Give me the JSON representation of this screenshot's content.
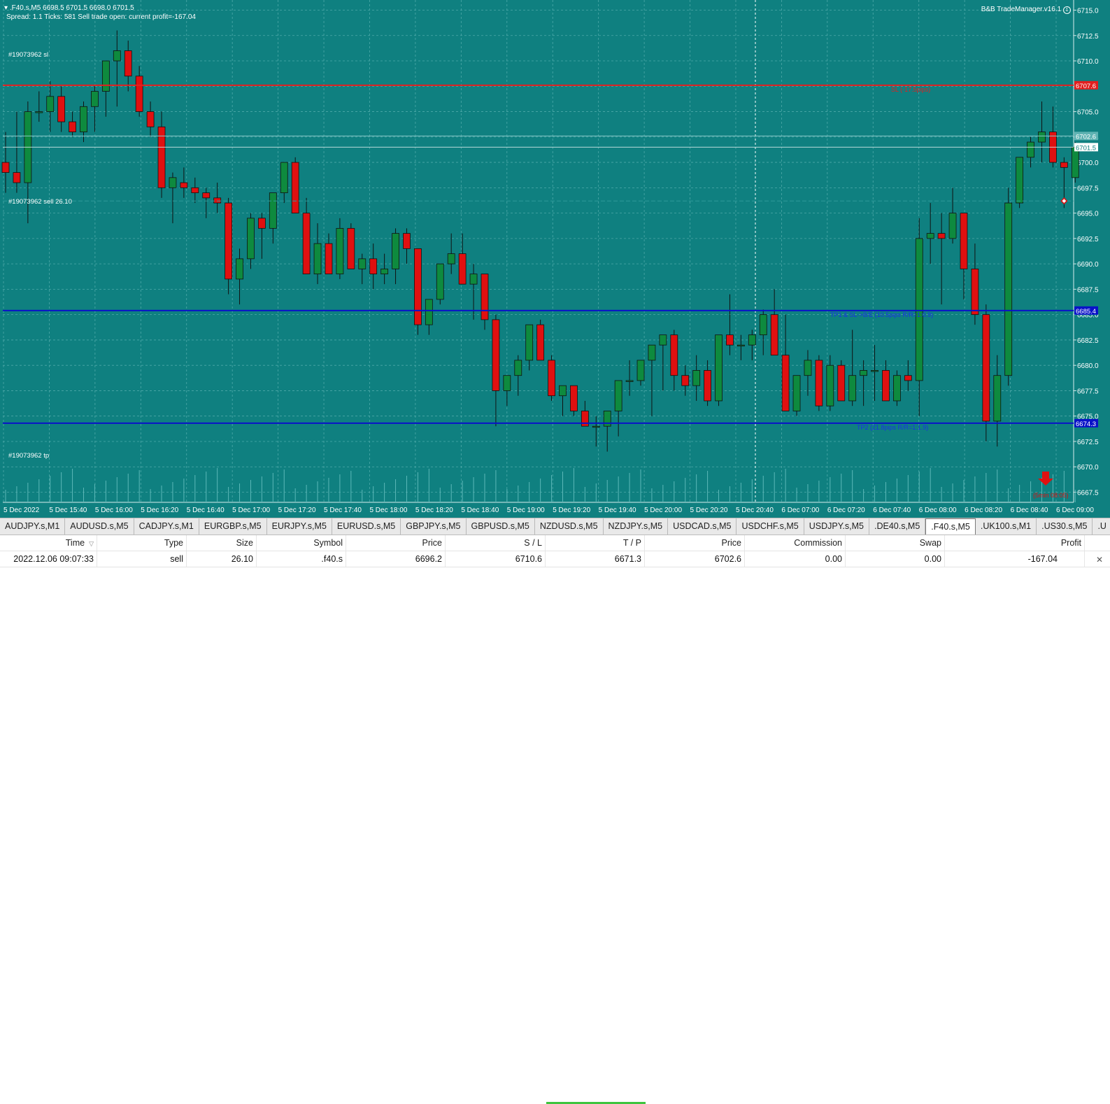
{
  "chart_header": {
    "symbol_line": ".F40.s,M5  6698.5 6701.5 6698.0 6701.5",
    "info_line": "Spread: 1.1  Ticks: 581  Sell trade open: current profit=-167.04",
    "brand": "B&B TradeManager.v16.1"
  },
  "chart_labels": {
    "order_sl": "#19073962 sl",
    "order_sell": "#19073962 sell 26.10",
    "order_tp": "#19073962 tp",
    "sl_text": "SL (-17.5pips)",
    "tp1_text": "TP1 & SL->B/E (10.5pips R/R=1:0.9)",
    "tp2_text": "TP2 (21.8pips R/R=1:1.9)",
    "timer": "(5min 08:05)"
  },
  "colors": {
    "background": "#0f8080",
    "bull": "#0e8a3e",
    "bear": "#e01010",
    "sl_line": "#e21f1f",
    "tp_line": "#0a12c8",
    "grid": "#4fa9a9"
  },
  "chart_data": {
    "type": "candlestick",
    "symbol": ".F40.s",
    "timeframe": "M5",
    "ylim": [
      6666.5,
      6716
    ],
    "yticks": [
      6715.0,
      6712.5,
      6710.0,
      6707.5,
      6705.0,
      6702.5,
      6700.0,
      6697.5,
      6695.0,
      6692.5,
      6690.0,
      6687.5,
      6685.0,
      6682.5,
      6680.0,
      6677.5,
      6675.0,
      6672.5,
      6670.0,
      6667.5
    ],
    "price_tags": {
      "sl": "6707.6",
      "ask": "6702.6",
      "bid": "6701.5",
      "tp1": "6685.4",
      "tp2": "6674.3"
    },
    "levels": {
      "sl": 6707.6,
      "ask": 6702.6,
      "bid": 6701.5,
      "tp1": 6685.4,
      "tp2": 6674.3,
      "entry": 6696.2
    },
    "xticks": [
      "5 Dec 2022",
      "5 Dec 15:40",
      "5 Dec 16:00",
      "5 Dec 16:20",
      "5 Dec 16:40",
      "5 Dec 17:00",
      "5 Dec 17:20",
      "5 Dec 17:40",
      "5 Dec 18:00",
      "5 Dec 18:20",
      "5 Dec 18:40",
      "5 Dec 19:00",
      "5 Dec 19:20",
      "5 Dec 19:40",
      "5 Dec 20:00",
      "5 Dec 20:20",
      "5 Dec 20:40",
      "6 Dec 07:00",
      "6 Dec 07:20",
      "6 Dec 07:40",
      "6 Dec 08:00",
      "6 Dec 08:20",
      "6 Dec 08:40",
      "6 Dec 09:00"
    ],
    "candles": [
      [
        6700,
        6703,
        6697,
        6699
      ],
      [
        6699,
        6705,
        6697,
        6698
      ],
      [
        6698,
        6706,
        6694,
        6705
      ],
      [
        6705,
        6707,
        6704,
        6705
      ],
      [
        6705,
        6708,
        6703,
        6706.5
      ],
      [
        6706.5,
        6707.5,
        6703,
        6704
      ],
      [
        6704,
        6705,
        6702.5,
        6703
      ],
      [
        6703,
        6706,
        6702,
        6705.5
      ],
      [
        6705.5,
        6707.5,
        6703,
        6707
      ],
      [
        6707,
        6709.5,
        6704.5,
        6710
      ],
      [
        6710,
        6713,
        6705.5,
        6711
      ],
      [
        6711,
        6712,
        6707,
        6708.5
      ],
      [
        6708.5,
        6709.5,
        6704.5,
        6705
      ],
      [
        6705,
        6706,
        6702.5,
        6703.5
      ],
      [
        6703.5,
        6705,
        6696.5,
        6697.5
      ],
      [
        6697.5,
        6699,
        6694,
        6698.5
      ],
      [
        6698,
        6699.5,
        6696.5,
        6697.5
      ],
      [
        6697.5,
        6698.5,
        6696,
        6697
      ],
      [
        6697,
        6697.5,
        6694.5,
        6696.5
      ],
      [
        6696.5,
        6698,
        6695,
        6696
      ],
      [
        6696,
        6696.5,
        6687,
        6688.5
      ],
      [
        6688.5,
        6691.5,
        6686,
        6690.5
      ],
      [
        6690.5,
        6695,
        6689.5,
        6694.5
      ],
      [
        6694.5,
        6695,
        6690.5,
        6693.5
      ],
      [
        6693.5,
        6696.5,
        6692,
        6697
      ],
      [
        6697,
        6699,
        6696,
        6700
      ],
      [
        6700,
        6700.5,
        6696,
        6695
      ],
      [
        6695,
        6696.5,
        6689,
        6689
      ],
      [
        6689,
        6694,
        6688,
        6692
      ],
      [
        6692,
        6693,
        6689,
        6689
      ],
      [
        6689,
        6694.5,
        6688.5,
        6693.5
      ],
      [
        6693.5,
        6694,
        6691,
        6689.5
      ],
      [
        6689.5,
        6691,
        6688,
        6690.5
      ],
      [
        6690.5,
        6692,
        6687.5,
        6689
      ],
      [
        6689,
        6691,
        6688,
        6689.5
      ],
      [
        6689.5,
        6693.5,
        6688,
        6693
      ],
      [
        6693,
        6693.5,
        6690,
        6691.5
      ],
      [
        6691.5,
        6691.5,
        6683,
        6684
      ],
      [
        6684,
        6686.5,
        6683,
        6686.5
      ],
      [
        6686.5,
        6690,
        6686,
        6690
      ],
      [
        6690,
        6693,
        6689,
        6691
      ],
      [
        6691,
        6693,
        6689,
        6688
      ],
      [
        6688,
        6690,
        6684.5,
        6689
      ],
      [
        6689,
        6689,
        6683.5,
        6684.5
      ],
      [
        6684.5,
        6685,
        6674,
        6677.5
      ],
      [
        6677.5,
        6679,
        6676,
        6679
      ],
      [
        6679,
        6681,
        6677,
        6680.5
      ],
      [
        6680.5,
        6683.5,
        6679.5,
        6684
      ],
      [
        6684,
        6684.5,
        6681,
        6680.5
      ],
      [
        6680.5,
        6681,
        6676.5,
        6677
      ],
      [
        6677,
        6677.5,
        6675,
        6678
      ],
      [
        6678,
        6678,
        6675,
        6675.5
      ],
      [
        6675.5,
        6676.5,
        6675,
        6674
      ],
      [
        6674,
        6675,
        6672,
        6674
      ],
      [
        6674,
        6675,
        6671.5,
        6675.5
      ],
      [
        6675.5,
        6678.5,
        6673,
        6678.5
      ],
      [
        6678.5,
        6680.5,
        6677,
        6678.5
      ],
      [
        6678.5,
        6680.5,
        6678,
        6680.5
      ],
      [
        6680.5,
        6681.5,
        6675,
        6682
      ],
      [
        6682,
        6683,
        6677.5,
        6683
      ],
      [
        6683,
        6683.5,
        6677.5,
        6679
      ],
      [
        6679,
        6680,
        6677,
        6678
      ],
      [
        6678,
        6681,
        6676.5,
        6679.5
      ],
      [
        6679.5,
        6680.5,
        6676,
        6676.5
      ],
      [
        6676.5,
        6683,
        6676,
        6683
      ],
      [
        6683,
        6687,
        6681,
        6682
      ],
      [
        6682,
        6683,
        6680.5,
        6682
      ],
      [
        6682,
        6683.5,
        6680.5,
        6683
      ],
      [
        6683,
        6685.5,
        6681,
        6685
      ],
      [
        6685,
        6687.5,
        6681,
        6681
      ],
      [
        6681,
        6685,
        6675.5,
        6675.5
      ],
      [
        6675.5,
        6679,
        6675,
        6679
      ],
      [
        6679,
        6681.5,
        6677,
        6680.5
      ],
      [
        6680.5,
        6681,
        6675.5,
        6676
      ],
      [
        6676,
        6681,
        6675.5,
        6680
      ],
      [
        6680,
        6680.5,
        6676.5,
        6676.5
      ],
      [
        6676.5,
        6683.5,
        6676,
        6679
      ],
      [
        6679,
        6680.5,
        6676,
        6679.5
      ],
      [
        6679.5,
        6682,
        6676.5,
        6679.5
      ],
      [
        6679.5,
        6680.5,
        6676.5,
        6676.5
      ],
      [
        6676.5,
        6679.5,
        6676,
        6679
      ],
      [
        6679,
        6680.5,
        6677.5,
        6678.5
      ],
      [
        6678.5,
        6694.5,
        6675,
        6692.5
      ],
      [
        6692.5,
        6696,
        6690,
        6693
      ],
      [
        6693,
        6695,
        6686,
        6692.5
      ],
      [
        6692.5,
        6697.5,
        6692,
        6695
      ],
      [
        6695,
        6695,
        6686.5,
        6689.5
      ],
      [
        6689.5,
        6692,
        6684,
        6685
      ],
      [
        6685,
        6686,
        6672.5,
        6674.5
      ],
      [
        6674.5,
        6681,
        6672,
        6679
      ],
      [
        6679,
        6697.5,
        6678,
        6696
      ],
      [
        6696,
        6700.5,
        6695.5,
        6700.5
      ],
      [
        6700.5,
        6702.5,
        6699.5,
        6702
      ],
      [
        6702,
        6706,
        6700,
        6703
      ],
      [
        6703,
        6705.5,
        6699.5,
        6700
      ],
      [
        6700,
        6700.5,
        6695.5,
        6699.5
      ],
      [
        6698.5,
        6702,
        6698,
        6701.5
      ]
    ]
  },
  "tabs": [
    "AUDJPY.s,M1",
    "AUDUSD.s,M5",
    "CADJPY.s,M1",
    "EURGBP.s,M5",
    "EURJPY.s,M5",
    "EURUSD.s,M5",
    "GBPJPY.s,M5",
    "GBPUSD.s,M5",
    "NZDUSD.s,M5",
    "NZDJPY.s,M5",
    "USDCAD.s,M5",
    "USDCHF.s,M5",
    "USDJPY.s,M5",
    ".DE40.s,M5",
    ".F40.s,M5",
    ".UK100.s,M1",
    ".US30.s,M5",
    ".U"
  ],
  "active_tab": ".F40.s,M5",
  "trade_table": {
    "headers": [
      "Time",
      "Type",
      "Size",
      "Symbol",
      "Price",
      "S / L",
      "T / P",
      "Price",
      "Commission",
      "Swap",
      "Profit"
    ],
    "rows": [
      [
        "2022.12.06 09:07:33",
        "sell",
        "26.10",
        ".f40.s",
        "6696.2",
        "6710.6",
        "6671.3",
        "6702.6",
        "0.00",
        "0.00",
        "-167.04"
      ]
    ]
  }
}
